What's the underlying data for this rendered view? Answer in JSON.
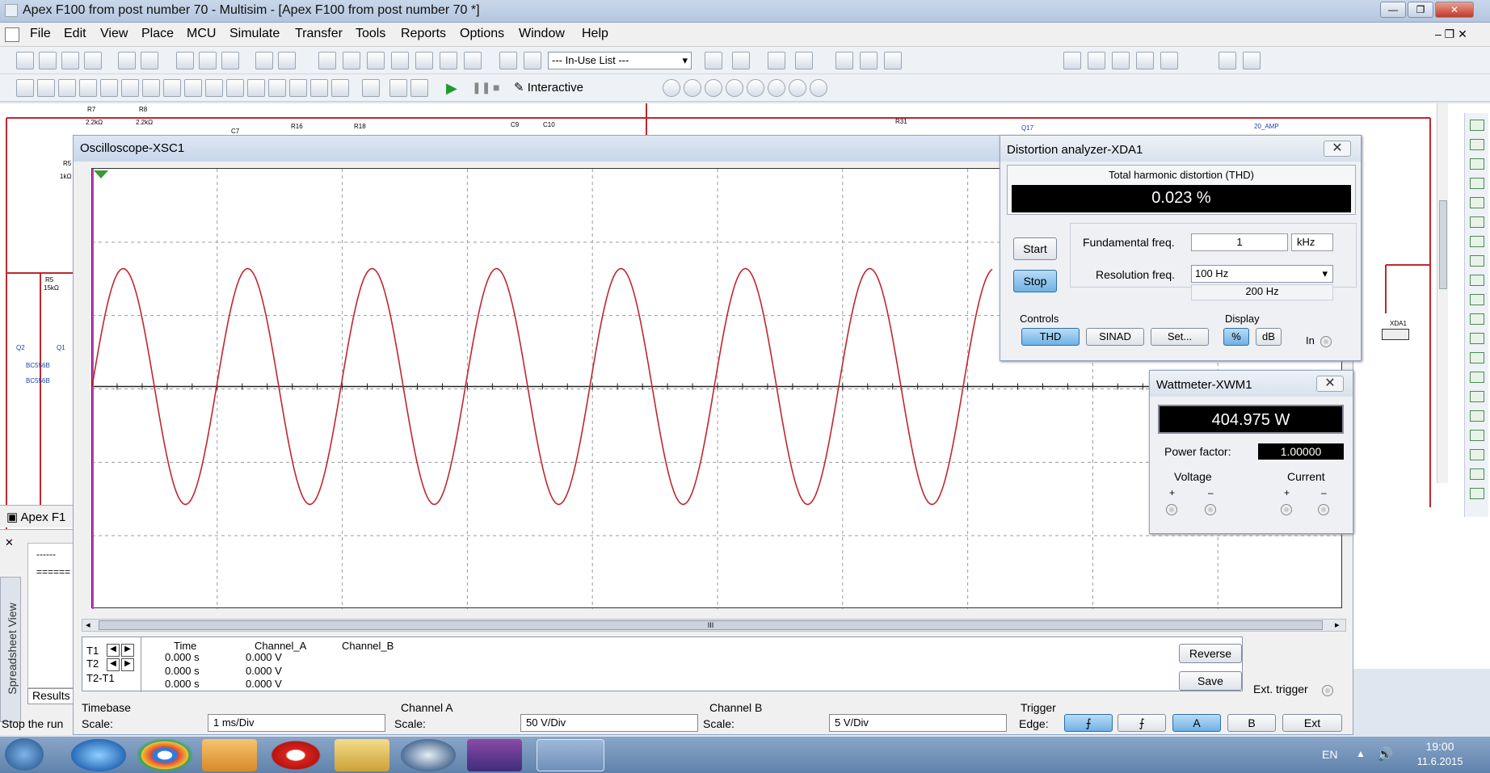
{
  "window": {
    "title": "Apex F100 from post number 70 - Multisim - [Apex F100 from post number 70 *]"
  },
  "menu": [
    "File",
    "Edit",
    "View",
    "Place",
    "MCU",
    "Simulate",
    "Transfer",
    "Tools",
    "Reports",
    "Options",
    "Window",
    "Help"
  ],
  "toolbar": {
    "inuse_list": "--- In-Use List ---",
    "mode": "Interactive"
  },
  "schematic_labels": [
    "R7",
    "2.2kΩ",
    "R8",
    "2.2kΩ",
    "C7",
    "R16",
    "R18",
    "C9",
    "C10",
    "R31",
    "Q17",
    "20_AMP",
    "R5",
    "1kΩ",
    "R5",
    "15kΩ",
    "Q2",
    "Q1",
    "BC556B",
    "BC556B",
    "XDA1"
  ],
  "bottom": {
    "tab": "Apex F1",
    "results_tab": "Results",
    "spreadsheet": "Spreadsheet View",
    "status": "Stop the run"
  },
  "osc": {
    "title": "Oscilloscope-XSC1",
    "t_table": {
      "headers": [
        "Time",
        "Channel_A",
        "Channel_B"
      ],
      "rows": [
        {
          "label": "T1",
          "time": "0.000 s",
          "a": "0.000 V"
        },
        {
          "label": "T2",
          "time": "0.000 s",
          "a": "0.000 V"
        },
        {
          "label": "T2-T1",
          "time": "0.000 s",
          "a": "0.000 V"
        }
      ]
    },
    "reverse": "Reverse",
    "save": "Save",
    "ext_trigger": "Ext. trigger",
    "timebase": {
      "label": "Timebase",
      "scale_label": "Scale:",
      "scale": "1 ms/Div"
    },
    "chA": {
      "label": "Channel A",
      "scale_label": "Scale:",
      "scale": "50  V/Div"
    },
    "chB": {
      "label": "Channel B",
      "scale_label": "Scale:",
      "scale": "5  V/Div"
    },
    "trigger": {
      "label": "Trigger",
      "edge_label": "Edge:",
      "btns": [
        "A",
        "B",
        "Ext"
      ]
    },
    "scroll_mark": "III",
    "trace": {
      "color": "#c0272d",
      "cycles": 7.5
    }
  },
  "da": {
    "title": "Distortion analyzer-XDA1",
    "thd_label": "Total harmonic distortion (THD)",
    "thd_value": "0.023 %",
    "start": "Start",
    "stop": "Stop",
    "fund_label": "Fundamental freq.",
    "fund_value": "1",
    "fund_unit": "kHz",
    "res_label": "Resolution freq.",
    "res_value": "100 Hz",
    "res_sub": "200 Hz",
    "controls": "Controls",
    "display": "Display",
    "thd_btn": "THD",
    "sinad_btn": "SINAD",
    "set_btn": "Set...",
    "pct_btn": "%",
    "db_btn": "dB",
    "in_label": "In"
  },
  "wm": {
    "title": "Wattmeter-XWM1",
    "power": "404.975 W",
    "pf_label": "Power factor:",
    "pf_value": "1.00000",
    "voltage": "Voltage",
    "current": "Current",
    "plus": "+",
    "minus": "–"
  },
  "tray": {
    "lang": "EN",
    "time": "19:00",
    "date": "11.6.2015"
  }
}
